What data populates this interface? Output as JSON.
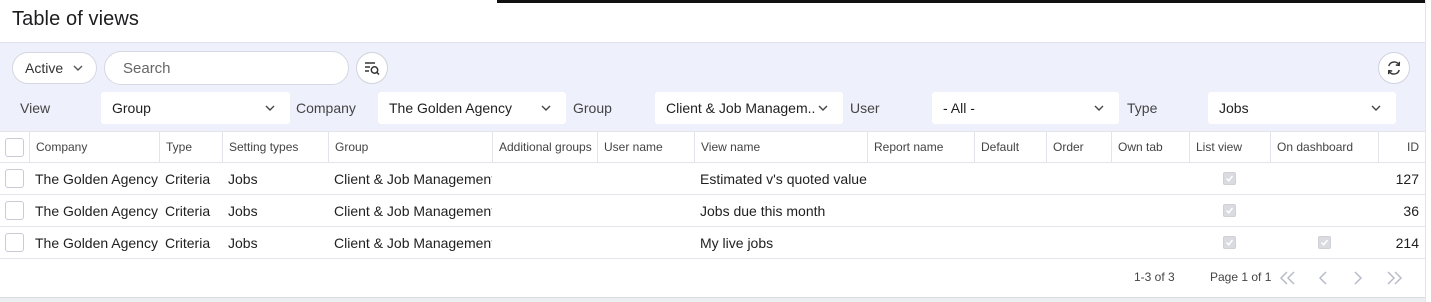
{
  "title": "Table of views",
  "status_filter": "Active",
  "search": {
    "placeholder": "Search"
  },
  "filters": [
    {
      "label": "View",
      "value": "Group"
    },
    {
      "label": "Company",
      "value": "The Golden Agency"
    },
    {
      "label": "Group",
      "value": "Client & Job Managem..."
    },
    {
      "label": "User",
      "value": "- All -"
    },
    {
      "label": "Type",
      "value": "Jobs"
    }
  ],
  "columns": [
    "Company",
    "Type",
    "Setting types",
    "Group",
    "Additional groups",
    "User name",
    "View name",
    "Report name",
    "Default",
    "Order",
    "Own tab",
    "List view",
    "On dashboard",
    "ID"
  ],
  "rows": [
    {
      "company": "The Golden Agency",
      "type": "Criteria",
      "setting_types": "Jobs",
      "group": "Client & Job Management",
      "additional_groups": "",
      "user_name": "",
      "view_name": "Estimated v's quoted value",
      "report_name": "",
      "default": "",
      "order": "",
      "own_tab": "",
      "list_view": true,
      "on_dashboard": false,
      "id": "127"
    },
    {
      "company": "The Golden Agency",
      "type": "Criteria",
      "setting_types": "Jobs",
      "group": "Client & Job Management",
      "additional_groups": "",
      "user_name": "",
      "view_name": "Jobs due this month",
      "report_name": "",
      "default": "",
      "order": "",
      "own_tab": "",
      "list_view": true,
      "on_dashboard": false,
      "id": "36"
    },
    {
      "company": "The Golden Agency",
      "type": "Criteria",
      "setting_types": "Jobs",
      "group": "Client & Job Management",
      "additional_groups": "",
      "user_name": "",
      "view_name": "My live jobs",
      "report_name": "",
      "default": "",
      "order": "",
      "own_tab": "",
      "list_view": true,
      "on_dashboard": true,
      "id": "214"
    }
  ],
  "footer": {
    "range": "1-3 of 3",
    "page": "Page 1 of 1"
  },
  "pager_icons": [
    "first-page-icon",
    "previous-page-icon",
    "next-page-icon",
    "last-page-icon"
  ],
  "colors": {
    "panel": "#eef0fb",
    "border": "#e2e4ea",
    "pager": "#b8bcc8"
  }
}
